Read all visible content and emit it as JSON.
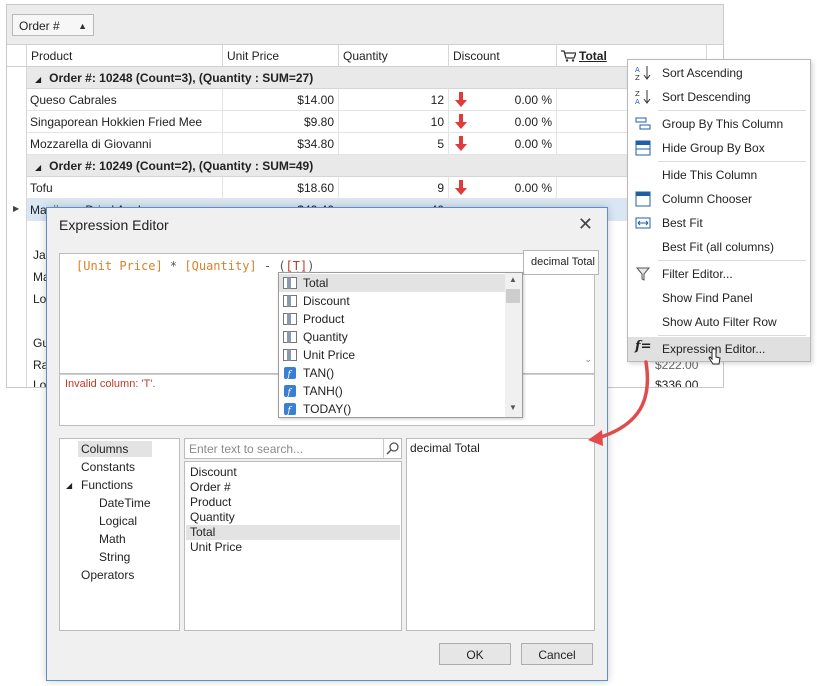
{
  "grid": {
    "group_box_label": "Order #",
    "columns": [
      "Product",
      "Unit Price",
      "Quantity",
      "Discount",
      "Total"
    ],
    "groups": [
      {
        "label": "Order #: 10248 (Count=3), (Quantity : SUM=27)"
      },
      {
        "label": "Order #: 10249 (Count=2), (Quantity : SUM=49)"
      }
    ],
    "rows": [
      {
        "product": "Queso Cabrales",
        "price": "$14.00",
        "qty": "12",
        "discount": "0.00 %"
      },
      {
        "product": "Singaporean Hokkien Fried Mee",
        "price": "$9.80",
        "qty": "10",
        "discount": "0.00 %"
      },
      {
        "product": "Mozzarella di Giovanni",
        "price": "$34.80",
        "qty": "5",
        "discount": "0.00 %"
      },
      {
        "product": "Tofu",
        "price": "$18.60",
        "qty": "9",
        "discount": "0.00 %"
      },
      {
        "product": "Manjimup Dried Apples",
        "price": "$42.40",
        "qty": "40",
        "discount": ""
      }
    ],
    "partial_rows": [
      "Jac",
      "Mar",
      "Lou",
      "Gus",
      "Rav",
      "Lou"
    ],
    "partial_totals": [
      "$222.00",
      "$336.00"
    ]
  },
  "menu": {
    "items": [
      "Sort Ascending",
      "Sort Descending",
      "Group By This Column",
      "Hide Group By Box",
      "Hide This Column",
      "Column Chooser",
      "Best Fit",
      "Best Fit (all columns)",
      "Filter Editor...",
      "Show Find Panel",
      "Show Auto Filter Row",
      "Expression Editor..."
    ]
  },
  "dialog": {
    "title": "Expression Editor",
    "expression": {
      "part1": "[Unit Price]",
      "op1": " * ",
      "part2": "[Quantity]",
      "op2": " - (",
      "part3": "[T]",
      "op3": ")"
    },
    "error": "Invalid column: 'T'.",
    "tooltip": "decimal Total",
    "autocomplete": [
      "Total",
      "Discount",
      "Product",
      "Quantity",
      "Unit Price",
      "TAN()",
      "TANH()",
      "TODAY()"
    ],
    "categories": [
      "Columns",
      "Constants",
      "Functions",
      "DateTime",
      "Logical",
      "Math",
      "String",
      "Operators"
    ],
    "search_placeholder": "Enter text to search...",
    "fields": [
      "Discount",
      "Order #",
      "Product",
      "Quantity",
      "Total",
      "Unit Price"
    ],
    "description": "decimal Total",
    "ok": "OK",
    "cancel": "Cancel"
  },
  "colors": {
    "accent": "#5b8fc9",
    "arrow": "#e03a3a",
    "callout": "#e04b4b",
    "error": "#c0392b",
    "column": "#d9822b"
  }
}
